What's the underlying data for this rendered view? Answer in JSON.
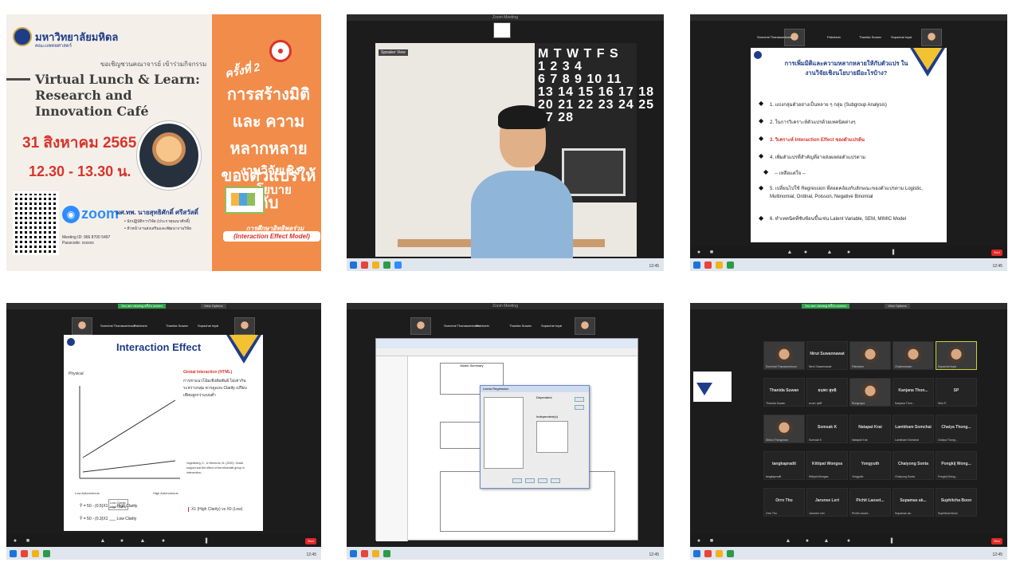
{
  "poster": {
    "university_name": "มหาวิทยาลัยมหิดล",
    "university_sub": "คณะแพทยศาสตร์",
    "invite_text": "ขอเชิญชวนคณาจารย์ เข้าร่วมกิจกรรม",
    "event_title": "Virtual Lunch & Learn: Research and Innovation Café",
    "date": "31 สิงหาคม 2565",
    "time": "12.30 - 13.30 น.",
    "zoom_label": "zoom",
    "meeting_info": "Meeting ID: 966 8700 5497\nPasscode: xxxxxx",
    "speaker": "ผศ.ทพ. นายสุทธิศักดิ์ ศรีสวัสดิ์",
    "speaker_roles": "• นักปฏิบัติการวิจัย (ประกาศุณนาศักดิ์)\n• หัวหน้างานส่งเสริมและพัฒนางานวิจัย",
    "session": "ครั้งที่ 2",
    "topic": "การสร้างมิติและ ความหลากหลาย ของตัวแปรให้กับ",
    "topic_small": "งานวิจัยเชิงนโยบาย",
    "model_label": "การศึกษาอิทธิพลร่วม",
    "model_name": "(Interaction Effect Model)"
  },
  "webcam_panel": {
    "window_title": "Zoom Meeting",
    "camera_label": "Speaker View",
    "calendar_text": "M T W T F S\n1 2 3 4\n6 7 8 9 10 11\n13 14 15 16 17 18\n20 21 22 23 24 25\n27 28"
  },
  "zoom_chrome": {
    "recording_tag": "You are viewing ครั้ง's screen",
    "view_options": "View Options",
    "end_label": "End",
    "clock": "12:45"
  },
  "participants_strip": [
    "Somchai Thanasomboon",
    "Patcharin",
    "Thanida Suwan",
    "Supachai Inyai"
  ],
  "slide_subgroup": {
    "heading": "การเพิ่มมิติและความหลากหลายให้กับตัวแปร ในงานวิจัยเชิงนโยบายมีอะไรบ้าง?",
    "bullets": [
      {
        "text": "1. แบ่งกลุ่มตัวอย่างเป็นหลาย ๆ กลุ่ม (Subgroup Analysis)",
        "emph": false
      },
      {
        "text": "2. ในการวิเคราะห์ตัวแปรด้วยเทคนิคต่างๆ",
        "emph": false
      },
      {
        "text": "3. วิเคราะห์ Interaction Effect ของตัวแปรต้น",
        "emph": true
      },
      {
        "text": "4. เพิ่มตัวแปรที่สำคัญที่อาจส่งผลต่อตัวแปรตาม",
        "emph": false
      },
      {
        "text": "-- เหลือแต่ใจ --",
        "emph": false
      },
      {
        "text": "5. เปลี่ยนไปใช้ Regression ที่สอดคล้องกับลักษณะของตัวแปรตาม Logistic, Multinomial, Ordinal, Poisson, Negative Binomial",
        "emph": false
      },
      {
        "text": "6. ทำเทคนิคที่ซับซ้อนขึ้นเช่น Latent Variable, SEM, MIMIC Model",
        "emph": false
      }
    ]
  },
  "slide_interaction": {
    "heading": "Interaction Effect",
    "y_label": "Physical",
    "x_left": "Low Autonomous",
    "x_right": "High Autonomous",
    "legend": [
      "Low Clarity",
      "High Clarity"
    ],
    "note_title": "Global Interaction (HTML)",
    "note_body": "การหาแนวโน้มเชิงสัมพันธ์ ไม่เท่ากันระหว่างกลุ่ม ควรดูแบบ Clarity เปรียบเทียบสูงกว่าแบบต่ำ",
    "reference": "Vogelsberg, K., & Heinrichs, M. (2020). Social support and the effect of the influential group in intervention...",
    "eq1": "Ŷ = 50 - (0.5)X1 ___ High Clarity",
    "eq2": "Ŷ = 50 - (0.3)X1 ___ Low Clarity",
    "eq_note": "X1 (High Clarity) vs X0 (Low)"
  },
  "spss": {
    "table_title": "Model Summary",
    "dialog_title": "Linear Regression",
    "dependent_label": "Dependent",
    "independent_label": "Independent(s)"
  },
  "gallery": {
    "tiles": [
      {
        "label": "",
        "name": "Somchai Thanasomboon",
        "face": true
      },
      {
        "label": "Nirut Suwannawat",
        "name": "Nirut Suwannawat",
        "face": false
      },
      {
        "label": "",
        "name": "Patcharin",
        "face": true
      },
      {
        "label": "",
        "name": "Chalermkwan",
        "face": true
      },
      {
        "label": "",
        "name": "Supachai Inyai",
        "face": true
      },
      {
        "label": "Thanida Suwan",
        "name": "Thanida Suwan",
        "face": false
      },
      {
        "label": "ธนพร สุทธิ",
        "name": "ธนพร สุทธิ",
        "face": false
      },
      {
        "label": "",
        "name": "Rungnapa",
        "face": true
      },
      {
        "label": "Kanjana Thon...",
        "name": "Kanjana Thon...",
        "face": false
      },
      {
        "label": "SP",
        "name": "Sirin P.",
        "face": false
      },
      {
        "label": "",
        "name": "Sirikul Thongchan",
        "face": true
      },
      {
        "label": "Somsak K",
        "name": "Somsak K",
        "face": false
      },
      {
        "label": "Natapat Krai",
        "name": "Natapat Krai",
        "face": false
      },
      {
        "label": "Lamkham Somchai",
        "name": "Lamkham Somchai",
        "face": false
      },
      {
        "label": "Chaiya Thong...",
        "name": "Chaiya Thong...",
        "face": false
      },
      {
        "label": "tangkapradit",
        "name": "tangkapradit",
        "face": false
      },
      {
        "label": "Kittipat Wongsa",
        "name": "Kittipat Wongsa",
        "face": false
      },
      {
        "label": "Yongyuth",
        "name": "Yongyuth",
        "face": false
      },
      {
        "label": "Chaiyong Sonta",
        "name": "Chaiyong Sonta",
        "face": false
      },
      {
        "label": "Pongkij Wong...",
        "name": "Pongkij Wong...",
        "face": false
      },
      {
        "label": "Orrn Tho",
        "name": "Orrn Tho",
        "face": false
      },
      {
        "label": "Jarunee Lert",
        "name": "Jarunee Lert",
        "face": false
      },
      {
        "label": "Pichit Laoset...",
        "name": "Pichit Laoset...",
        "face": false
      },
      {
        "label": "Supamas ak...",
        "name": "Supamas ak...",
        "face": false
      },
      {
        "label": "Suphitcha Boon",
        "name": "Suphitcha Boon",
        "face": false
      }
    ]
  },
  "colors": {
    "brand_blue": "#1f3c88",
    "accent_red": "#d9332b",
    "poster_orange": "#f28c4a",
    "zoom_blue": "#2d8cff"
  }
}
